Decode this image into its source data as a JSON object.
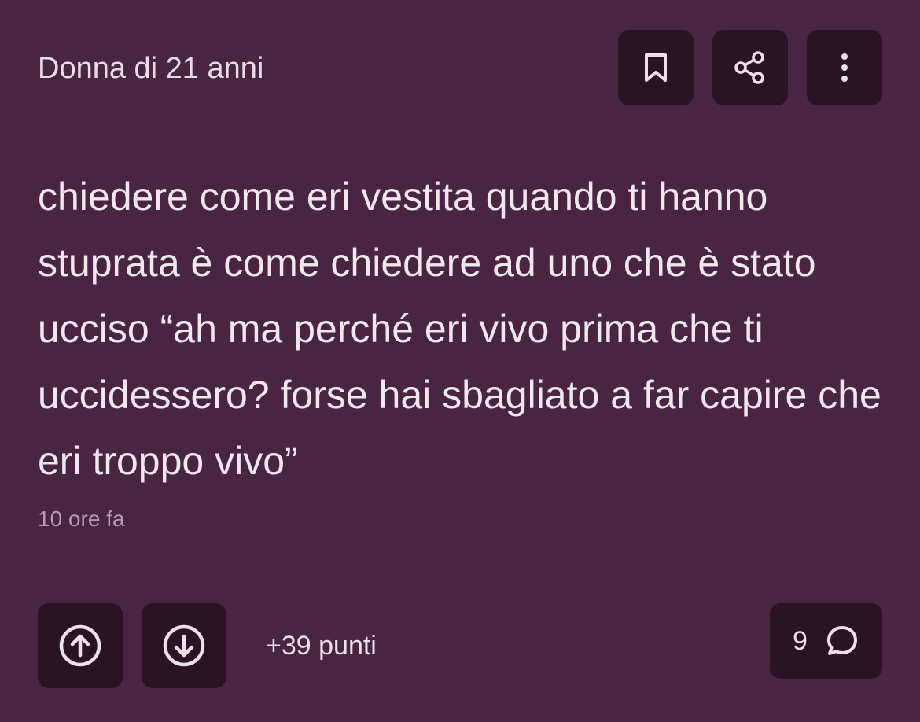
{
  "post": {
    "author": "Donna di 21 anni",
    "body": "chiedere come eri vestita quando ti hanno stuprata è come chiedere ad uno che è stato ucciso “ah ma perché eri vivo prima che ti uccidessero? forse hai sbagliato a far capire che eri troppo vivo”",
    "timestamp": "10 ore fa",
    "score": "+39 punti",
    "comments_count": "9"
  },
  "icons": {
    "bookmark": "bookmark-icon",
    "share": "share-icon",
    "more": "more-vertical-icon",
    "upvote": "arrow-up-circle-icon",
    "downvote": "arrow-down-circle-icon",
    "comment": "comment-bubble-icon"
  },
  "colors": {
    "background": "#4a2541",
    "button_bg": "#2a1424",
    "text": "#ece1e8",
    "muted_text": "#b49caf"
  }
}
